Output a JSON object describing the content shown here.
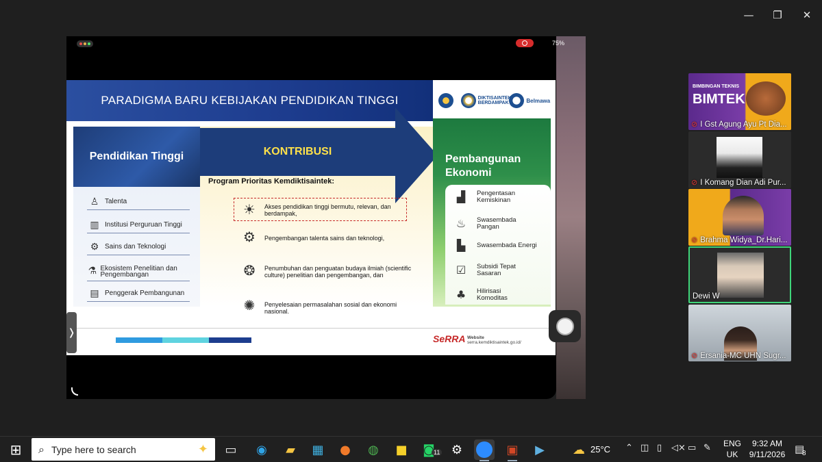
{
  "window_controls": {
    "minimize": "—",
    "maximize": "❐",
    "close": "✕"
  },
  "shared_screen": {
    "battery": "75%",
    "slide": {
      "title": "PARADIGMA BARU KEBIJAKAN PENDIDIKAN TINGGI",
      "logos": [
        "",
        "DIKTISAINTEK BERDAMPAK",
        "Belmawa"
      ],
      "left": {
        "heading": "Pendidikan Tinggi",
        "items": [
          {
            "label": "Talenta",
            "icon": "graduate-icon"
          },
          {
            "label": "Institusi Perguruan Tinggi",
            "icon": "building-icon"
          },
          {
            "label": "Sains dan Teknologi",
            "icon": "gears-icon"
          },
          {
            "label": "Ekosistem Penelitian dan Pengembangan",
            "icon": "lab-icon"
          },
          {
            "label": "Penggerak Pembangunan",
            "icon": "board-icon"
          }
        ]
      },
      "middle": {
        "heading": "KONTRIBUSI",
        "subheading": "Program Prioritas Kemdiktisaintek:",
        "items": [
          {
            "label": "Akses pendidikan tinggi bermutu, relevan, dan berdampak,",
            "icon": "bulb-book-icon"
          },
          {
            "label": "Pengembangan talenta sains dan teknologi,",
            "icon": "head-gear-icon"
          },
          {
            "label": "Penumbuhan dan penguatan budaya ilmiah (scientific culture) penelitian dan pengembangan, dan",
            "icon": "brain-icon"
          },
          {
            "label": "Penyelesaian permasalahan sosial dan ekonomi nasional.",
            "icon": "solution-icon"
          }
        ]
      },
      "right": {
        "heading_line1": "Pembangunan",
        "heading_line2": "Ekonomi",
        "items": [
          {
            "label": "Pengentasan Kemiskinan",
            "icon": "growth-chart-icon"
          },
          {
            "label": "Swasembada Pangan",
            "icon": "food-icon"
          },
          {
            "label": "Swasembada Energi",
            "icon": "factory-icon"
          },
          {
            "label": "Subsidi Tepat Sasaran",
            "icon": "checklist-icon"
          },
          {
            "label": "Hilirisasi Komoditas",
            "icon": "plant-icon"
          }
        ]
      },
      "footer": {
        "brand": "SeRRA",
        "url_label": "Website",
        "url": "serra.kemdiktisaintek.go.id/"
      }
    }
  },
  "participants": [
    {
      "name": "I Gst Agung Ayu Pt Dia...",
      "muted": true,
      "tile_text_1": "BIMBINGAN TEKNIS",
      "tile_text_2": "BIMTEK"
    },
    {
      "name": "I Komang Dian Adi Pur...",
      "muted": true
    },
    {
      "name": "Brahma Widya_Dr.Hari...",
      "muted": true
    },
    {
      "name": "Dewi W",
      "muted": false,
      "active": true
    },
    {
      "name": "Ersania-MC UHN Sugr...",
      "muted": true
    }
  ],
  "taskbar": {
    "search_placeholder": "Type here to search",
    "whatsapp_badge": "11",
    "temperature": "25°C",
    "language_1": "ENG",
    "language_2": "UK",
    "time": "9:32 AM",
    "date": "9/11/2026",
    "notification_count": "8"
  }
}
